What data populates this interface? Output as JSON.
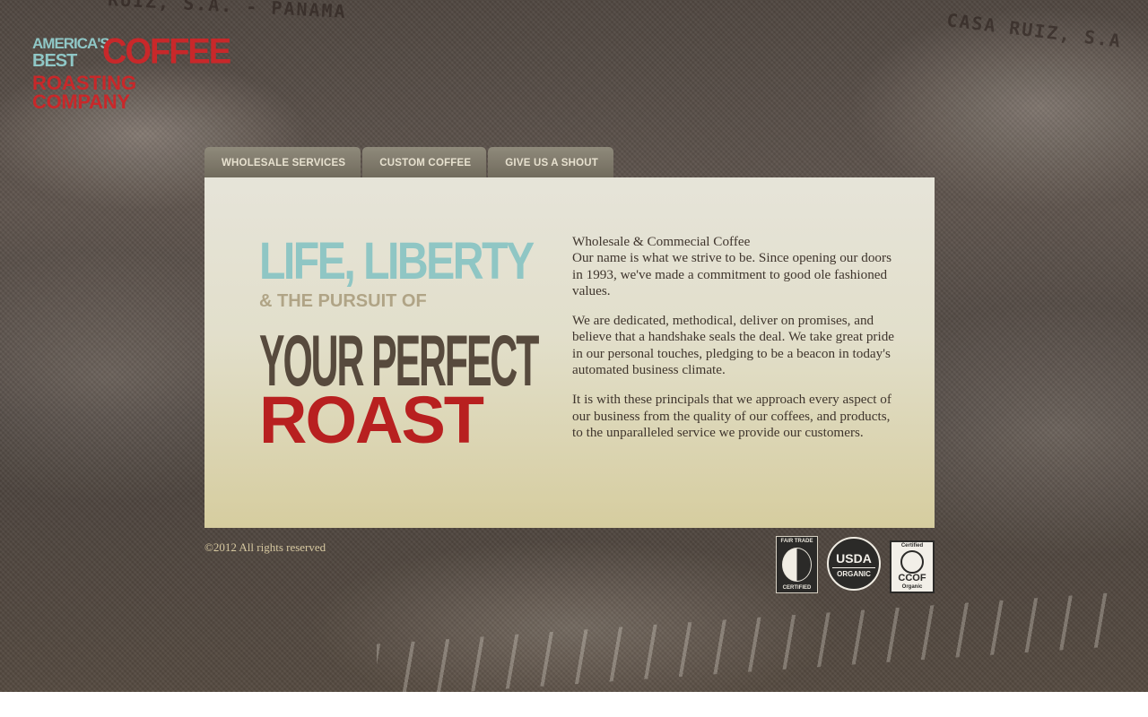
{
  "logo": {
    "line1": "AMERICA'S",
    "line2": "BEST",
    "line3": "COFFEE",
    "line4": "ROASTING",
    "line5": "COMPANY"
  },
  "background": {
    "sack_text_1": "CASA RUIZ, S.A",
    "sack_text_2": "RUIZ, S.A. - PANAMA"
  },
  "nav": {
    "tabs": [
      {
        "label": "WHOLESALE SERVICES"
      },
      {
        "label": "CUSTOM COFFEE"
      },
      {
        "label": "GIVE US A SHOUT"
      }
    ]
  },
  "headline": {
    "line1": "LIFE, LIBERTY",
    "line2": "& THE PURSUIT OF",
    "line3": "YOUR PERFECT",
    "line4": "ROAST"
  },
  "body": {
    "heading": "Wholesale & Commecial Coffee",
    "paragraph1": "Our name is what we strive to be. Since opening our doors in 1993, we've made a commitment to good ole fashioned values.",
    "paragraph2": "We are dedicated, methodical, deliver on promises, and believe that a handshake seals the deal. We take great pride in our personal touches, pledging to be a beacon in today's automated business climate.",
    "paragraph3": "It is with these principals that we approach every aspect of our business from the quality of our coffees, and products, to the unparalleled service we provide our customers."
  },
  "footer": {
    "copyright": "©2012 All rights reserved",
    "badges": {
      "fair_trade_top": "FAIR TRADE",
      "fair_trade_bottom": "CERTIFIED",
      "usda_top": "USDA",
      "usda_bottom": "ORGANIC",
      "ccof_top": "Certified",
      "ccof_mid": "CCOF",
      "ccof_bottom": "Organic"
    }
  },
  "colors": {
    "teal": "#8fc6c4",
    "red": "#b82020",
    "brown": "#574a3d",
    "tan": "#b0a486",
    "tab": "#7f7a6c"
  }
}
